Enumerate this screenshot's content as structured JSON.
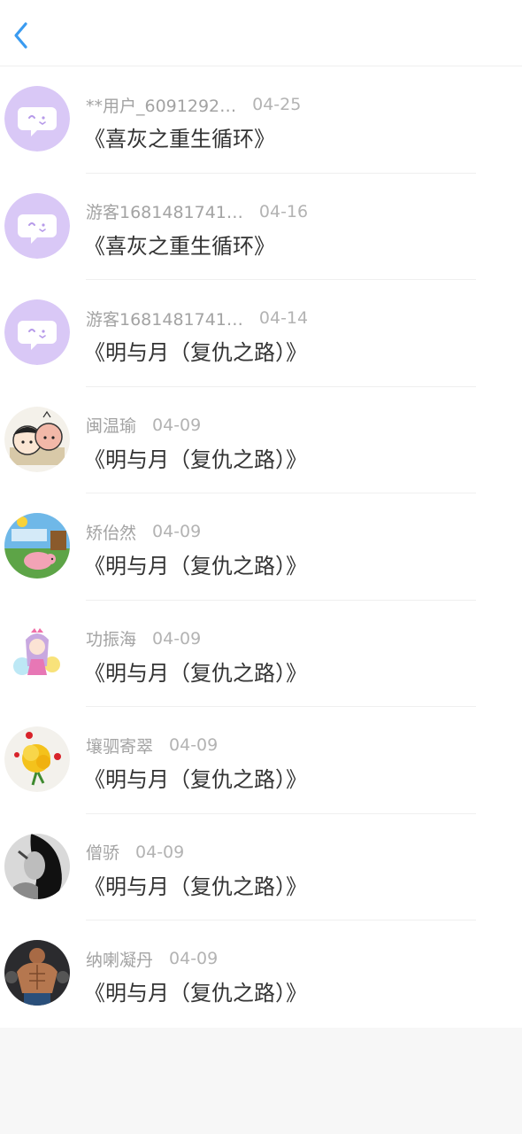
{
  "header": {
    "back_icon": "chevron-left-icon",
    "accent": "#3a9bf0"
  },
  "items": [
    {
      "name": "**用户_6091292…",
      "date": "04-25",
      "title": "《喜灰之重生循环》",
      "avatar": "default-chat-avatar"
    },
    {
      "name": "游客1681481741…",
      "date": "04-16",
      "title": "《喜灰之重生循环》",
      "avatar": "default-chat-avatar"
    },
    {
      "name": "游客1681481741…",
      "date": "04-14",
      "title": "《明与月（复仇之路）》",
      "avatar": "default-chat-avatar"
    },
    {
      "name": "闽温瑜",
      "date": "04-09",
      "title": "《明与月（复仇之路）》",
      "avatar": "cartoon-faces-avatar"
    },
    {
      "name": "矫佁然",
      "date": "04-09",
      "title": "《明与月（复仇之路）》",
      "avatar": "pig-farm-avatar"
    },
    {
      "name": "功振海",
      "date": "04-09",
      "title": "《明与月（复仇之路）》",
      "avatar": "anime-girl-avatar"
    },
    {
      "name": "壤驷寄翠",
      "date": "04-09",
      "title": "《明与月（复仇之路）》",
      "avatar": "flower-avatar"
    },
    {
      "name": "僧骄",
      "date": "04-09",
      "title": "《明与月（复仇之路）》",
      "avatar": "bw-portrait-avatar"
    },
    {
      "name": "纳喇凝丹",
      "date": "04-09",
      "title": "《明与月（复仇之路）》",
      "avatar": "muscle-man-avatar"
    }
  ]
}
